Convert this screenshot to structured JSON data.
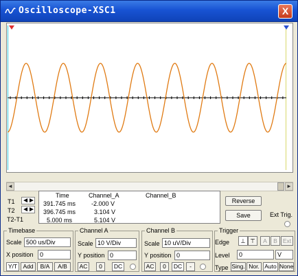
{
  "window": {
    "title": "Oscilloscope-XSC1",
    "close_label": "X"
  },
  "icons": {
    "title": "oscilloscope-icon",
    "close": "close-icon"
  },
  "colors": {
    "trace": "#e07a12",
    "cursor1": "#ff3a3a",
    "cursor2": "#2a4fcf",
    "axis": "#000000"
  },
  "chart_data": {
    "type": "line",
    "title": "",
    "xlabel": "",
    "ylabel": "",
    "grid": false,
    "series": [
      {
        "name": "Channel_A",
        "waveform": "sine",
        "cycles": 7.5,
        "amplitude_divs": 2.5,
        "start_phase_deg": 270
      }
    ]
  },
  "scrollbar": {
    "left_arrow": "◄",
    "right_arrow": "►"
  },
  "readout": {
    "headers": {
      "time": "Time",
      "channel_a": "Channel_A",
      "channel_b": "Channel_B"
    },
    "rows": [
      {
        "label": "T1",
        "time": "391.745 ms",
        "channel_a": "-2.000 V",
        "channel_b": ""
      },
      {
        "label": "T2",
        "time": "396.745 ms",
        "channel_a": "3.104 V",
        "channel_b": ""
      },
      {
        "label": "T2-T1",
        "time": "5.000 ms",
        "channel_a": "5.104 V",
        "channel_b": ""
      }
    ],
    "arrow_glyph": "◄►"
  },
  "buttons": {
    "reverse": "Reverse",
    "save": "Save",
    "ext_trig": "Ext Trig."
  },
  "timebase": {
    "label": "Timebase",
    "scale_label": "Scale",
    "scale_value": "500 us/Div",
    "xpos_label": "X position",
    "xpos_value": "0",
    "modes": [
      "Y/T",
      "Add",
      "B/A",
      "A/B"
    ]
  },
  "channel_a": {
    "label": "Channel A",
    "scale_label": "Scale",
    "scale_value": "10  V/Div",
    "ypos_label": "Y position",
    "ypos_value": "0",
    "coupling": [
      "AC",
      "0",
      "DC"
    ]
  },
  "channel_b": {
    "label": "Channel B",
    "scale_label": "Scale",
    "scale_value": "10  uV/Div",
    "ypos_label": "Y position",
    "ypos_value": "0",
    "coupling": [
      "AC",
      "0",
      "DC",
      "-"
    ]
  },
  "trigger": {
    "label": "Trigger",
    "edge_label": "Edge",
    "edge_rising": "⊥",
    "edge_falling": "⊤",
    "sources": [
      "A",
      "B",
      "Ext"
    ],
    "level_label": "Level",
    "level_value": "0",
    "level_unit": "V",
    "type_label": "Type",
    "types": [
      "Sing.",
      "Nor.",
      "Auto",
      "None"
    ]
  }
}
